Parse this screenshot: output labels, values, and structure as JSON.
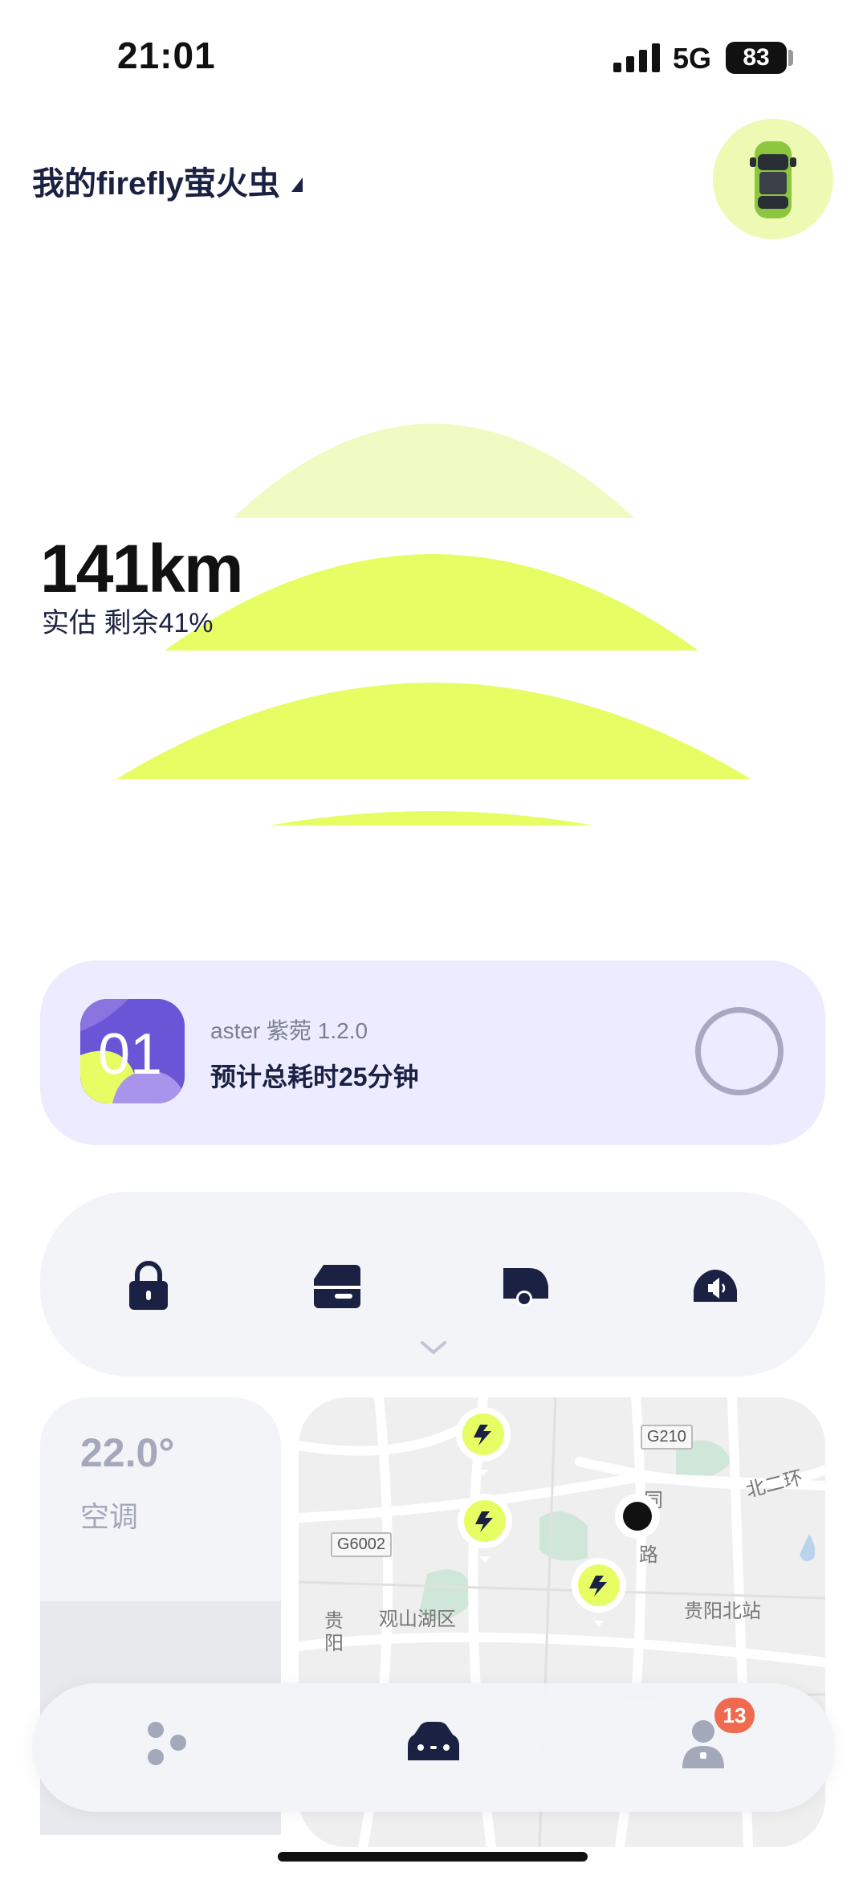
{
  "status_bar": {
    "time": "21:01",
    "network": "5G",
    "battery": "83"
  },
  "header": {
    "vehicle_title": "我的firefly萤火虫"
  },
  "range": {
    "value": "141km",
    "subtitle": "实估 剩余41%"
  },
  "update_card": {
    "app_number": "01",
    "name_version": "aster 紫菀 1.2.0",
    "estimated_time": "预计总耗时25分钟"
  },
  "controls": {
    "icons": [
      "lock-icon",
      "trunk-icon",
      "tailgate-icon",
      "horn-icon"
    ],
    "expand_icon": "chevron-down-icon"
  },
  "climate": {
    "temperature": "22.0°",
    "label": "空调"
  },
  "map": {
    "labels": {
      "g210": "G210",
      "g6002": "G6002",
      "ring": "北二环",
      "district": "观山湖区",
      "station": "贵阳北站",
      "road": "同",
      "road2": "路",
      "gui": "贵",
      "yang": "阳"
    }
  },
  "nav": {
    "items": [
      "discover-icon",
      "car-icon",
      "profile-icon"
    ],
    "profile_badge": "13"
  },
  "colors": {
    "accent": "#e6fd63",
    "dark": "#1a2142",
    "purple": "#6a55d6",
    "badge": "#ef6a4e"
  }
}
